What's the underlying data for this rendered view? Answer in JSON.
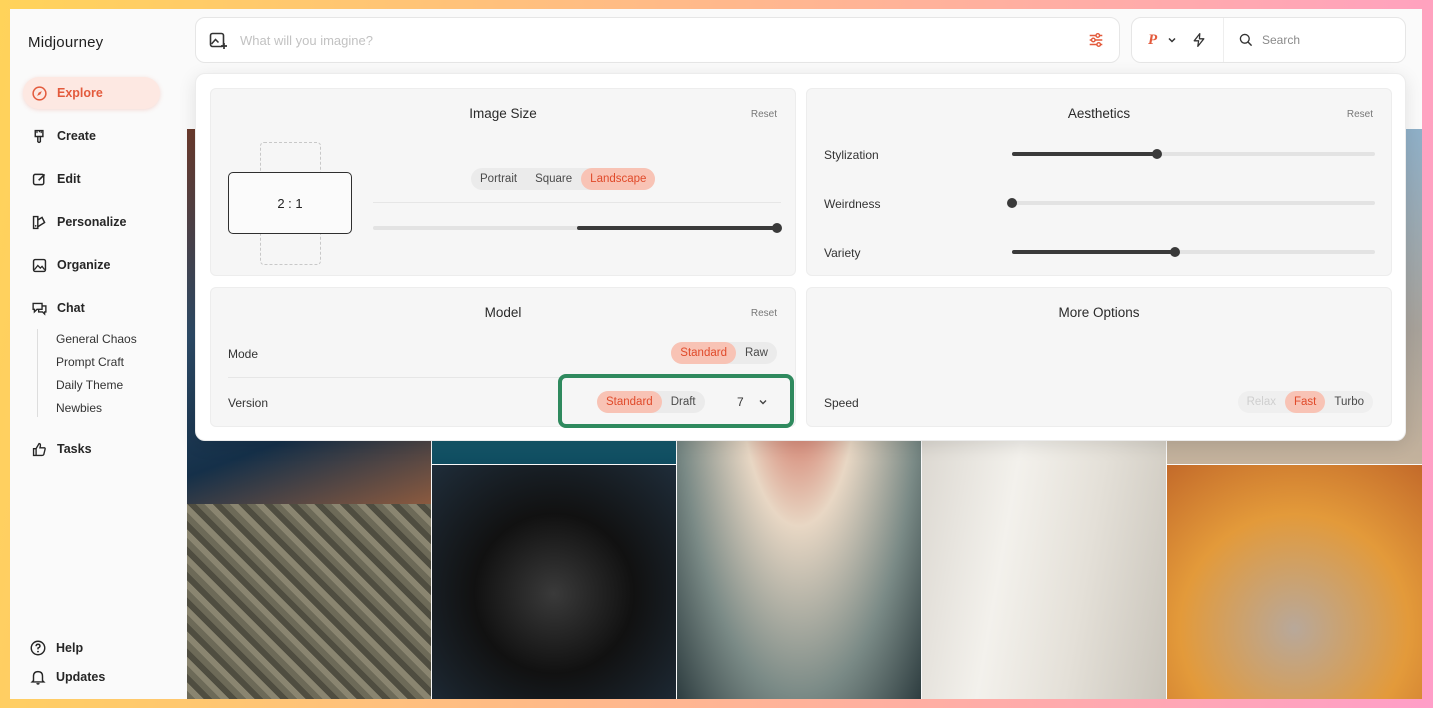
{
  "app": {
    "title": "Midjourney"
  },
  "sidebar": {
    "items": [
      {
        "label": "Explore",
        "icon": "compass-icon",
        "active": true
      },
      {
        "label": "Create",
        "icon": "brush-icon",
        "active": false
      },
      {
        "label": "Edit",
        "icon": "edit-icon",
        "active": false
      },
      {
        "label": "Personalize",
        "icon": "personalize-icon",
        "active": false
      },
      {
        "label": "Organize",
        "icon": "image-folder-icon",
        "active": false
      },
      {
        "label": "Chat",
        "icon": "chat-icon",
        "active": false
      }
    ],
    "chat_rooms": [
      "General Chaos",
      "Prompt Craft",
      "Daily Theme",
      "Newbies"
    ],
    "tasks": {
      "label": "Tasks",
      "icon": "thumbs-up-icon"
    },
    "bottom": [
      {
        "label": "Help",
        "icon": "help-icon"
      },
      {
        "label": "Updates",
        "icon": "bell-icon"
      }
    ]
  },
  "topbar": {
    "prompt_placeholder": "What will you imagine?",
    "search_placeholder": "Search",
    "profile_glyph": "P"
  },
  "settings": {
    "image_size": {
      "title": "Image Size",
      "reset": "Reset",
      "ratio": "2 : 1",
      "orientations": [
        "Portrait",
        "Square",
        "Landscape"
      ],
      "selected": "Landscape",
      "ratio_slider": 0.98
    },
    "aesthetics": {
      "title": "Aesthetics",
      "reset": "Reset",
      "sliders": [
        {
          "label": "Stylization",
          "value": 0.4
        },
        {
          "label": "Weirdness",
          "value": 0.0
        },
        {
          "label": "Variety",
          "value": 0.45
        }
      ]
    },
    "model": {
      "title": "Model",
      "reset": "Reset",
      "mode_label": "Mode",
      "mode_options": [
        "Standard",
        "Raw"
      ],
      "mode_selected": "Standard",
      "version_label": "Version",
      "version_options": [
        "Standard",
        "Draft"
      ],
      "version_selected": "Standard",
      "version_number": "7"
    },
    "more_options": {
      "title": "More Options",
      "speed_label": "Speed",
      "speed_options": [
        "Relax",
        "Fast",
        "Turbo"
      ],
      "speed_selected": "Fast"
    }
  },
  "colors": {
    "accent": "#e35a3c",
    "accent_soft": "#f8c3b5",
    "highlight_box": "#2f8a5e"
  }
}
